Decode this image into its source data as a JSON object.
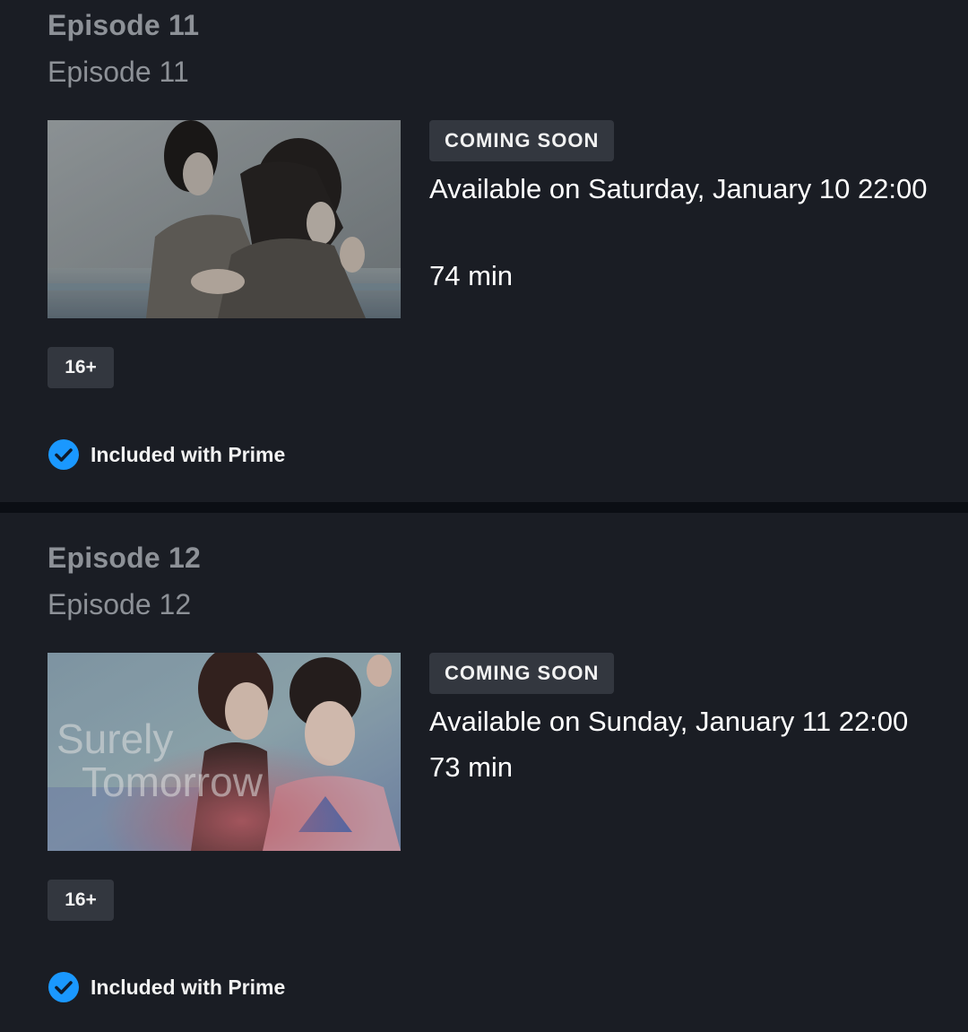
{
  "episodes": [
    {
      "title": "Episode 11",
      "subtitle": "Episode 11",
      "badge": "COMING SOON",
      "availability": "Available on Saturday, January 10 22:00",
      "duration": "74 min",
      "rating": "16+",
      "included": "Included with Prime",
      "thumbnail_icon": "episode-still-couple-hug"
    },
    {
      "title": "Episode 12",
      "subtitle": "Episode 12",
      "badge": "COMING SOON",
      "availability": "Available on Sunday, January 11 22:00",
      "duration": "73 min",
      "rating": "16+",
      "included": "Included with Prime",
      "thumbnail_icon": "episode-still-title-card",
      "thumbnail_text_line1": "Surely",
      "thumbnail_text_line2": "Tomorrow"
    }
  ],
  "colors": {
    "background": "#1a1d24",
    "divider": "#0b0e14",
    "badge_bg": "#33373f",
    "muted_text": "#8d9197",
    "check_blue": "#1a98ff"
  }
}
